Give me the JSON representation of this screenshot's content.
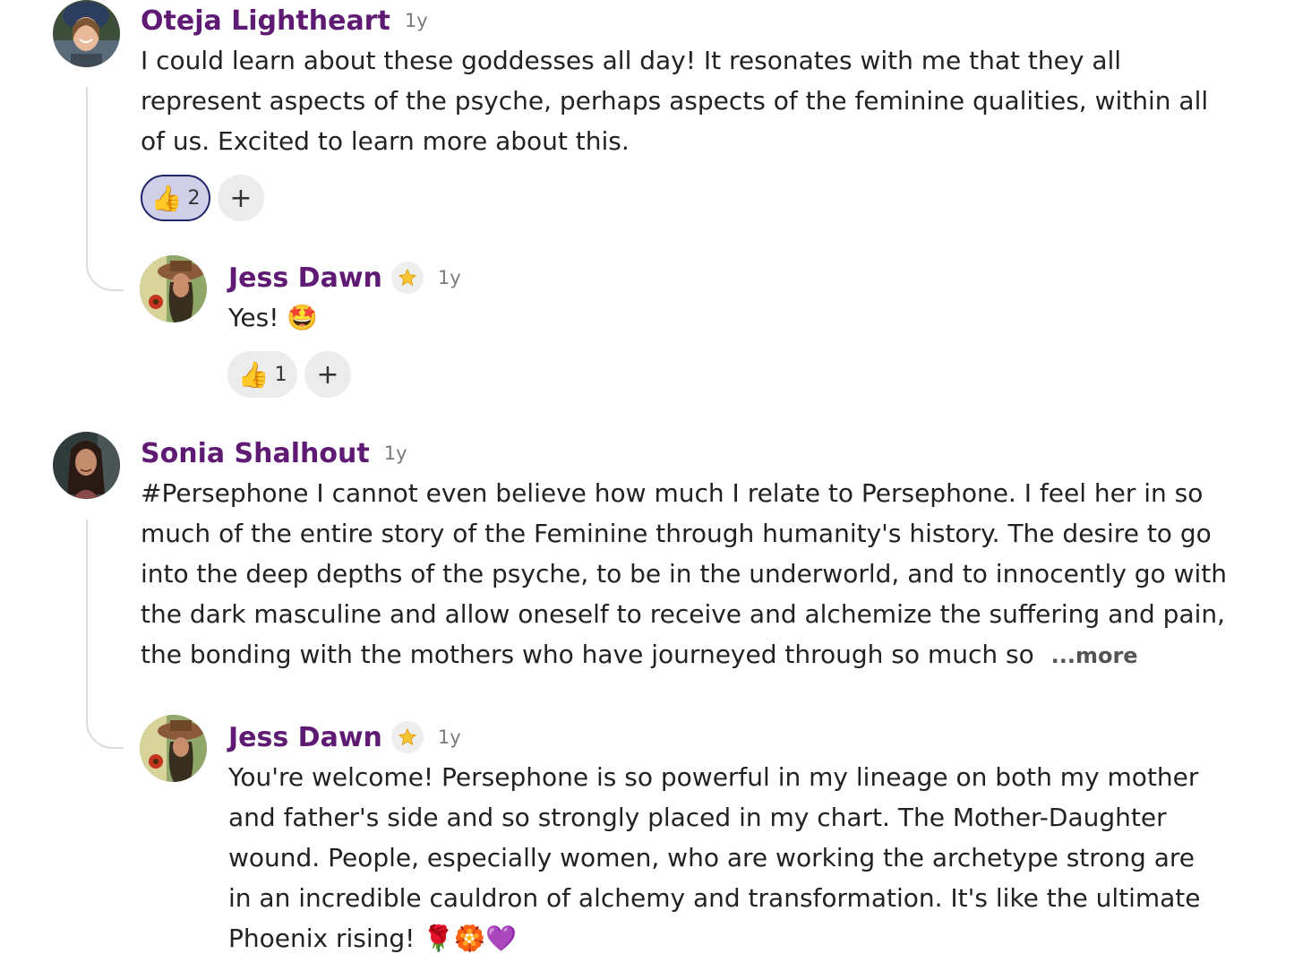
{
  "comments": [
    {
      "author": "Oteja Lightheart",
      "time": "1y",
      "lines": [
        "I could learn about these goddesses all day! It resonates with me that they all",
        "represent aspects of the psyche, perhaps aspects of the feminine qualities, within all",
        "of us. Excited to learn more about this."
      ],
      "reaction": {
        "icon": "thumbs-up-icon",
        "count": "2"
      },
      "add_reaction": "+"
    },
    {
      "author": "Jess Dawn",
      "time": "1y",
      "badge": "star-icon",
      "lines": [
        "Yes!"
      ],
      "emoji": "🤩",
      "reaction": {
        "icon": "thumbs-up-icon",
        "count": "1"
      },
      "add_reaction": "+"
    },
    {
      "author": "Sonia Shalhout",
      "time": "1y",
      "lines": [
        "#Persephone I cannot even believe how much I relate to Persephone. I feel her in so",
        "much of the entire story of the Feminine through humanity's history. The desire to go",
        "into the deep depths of the psyche, to be in the underworld, and to innocently go with",
        "the dark masculine and allow oneself to receive and alchemize the suffering and pain,",
        "the bonding with the mothers who have journeyed through so much so"
      ],
      "more_label": "...more"
    },
    {
      "author": "Jess Dawn",
      "time": "1y",
      "badge": "star-icon",
      "lines": [
        "You're welcome! Persephone is so powerful in my lineage on both my mother",
        "and father's side and so strongly placed in my chart. The Mother-Daughter",
        "wound. People, especially women, who are working the archetype strong are",
        "in an incredible cauldron of alchemy and transformation. It's like the ultimate",
        "Phoenix rising!"
      ],
      "emoji": "🌹🏵️💜"
    }
  ]
}
